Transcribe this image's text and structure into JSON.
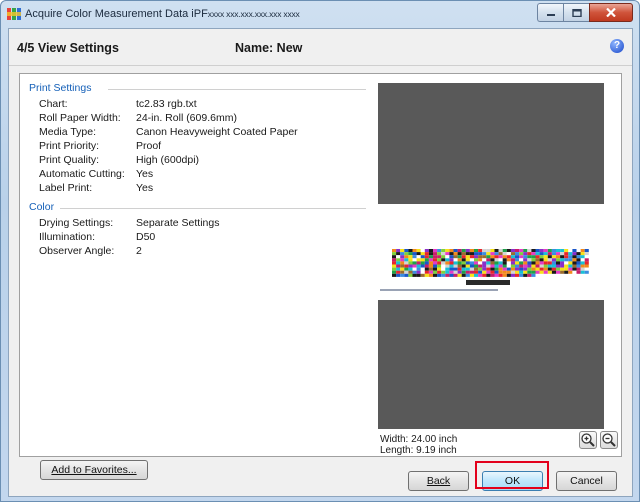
{
  "window": {
    "title": "Acquire Color Measurement Data iPF",
    "title_host": "xxxx xxx.xxx.xxx.xxx xxxx",
    "controls": [
      "minimize-icon",
      "maximize-icon",
      "close-icon"
    ]
  },
  "header": {
    "step": "4/5 View Settings",
    "name": "Name: New",
    "help": "?"
  },
  "print_settings": {
    "title": "Print Settings",
    "rows": [
      {
        "label": "Chart:",
        "value": "tc2.83 rgb.txt"
      },
      {
        "label": "Roll Paper Width:",
        "value": "24-in. Roll (609.6mm)"
      },
      {
        "label": "Media Type:",
        "value": "Canon Heavyweight Coated Paper"
      },
      {
        "label": "Print Priority:",
        "value": "Proof"
      },
      {
        "label": "Print Quality:",
        "value": "High (600dpi)"
      },
      {
        "label": "Automatic Cutting:",
        "value": "Yes"
      },
      {
        "label": "Label Print:",
        "value": "Yes"
      }
    ]
  },
  "color": {
    "title": "Color",
    "rows": [
      {
        "label": "Drying Settings:",
        "value": "Separate Settings"
      },
      {
        "label": "Illumination:",
        "value": "D50"
      },
      {
        "label": "Observer Angle:",
        "value": "2"
      }
    ]
  },
  "preview": {
    "width": "Width: 24.00 inch",
    "length": "Length: 9.19 inch",
    "zoom_in_icon": "zoom-in-icon",
    "zoom_out_icon": "zoom-out-icon",
    "background": "#595959"
  },
  "buttons": {
    "favorites": "Add to Favorites...",
    "back": "Back",
    "ok": "OK",
    "cancel": "Cancel"
  },
  "colors": {
    "accent": "#1560b8",
    "highlight": "#e3001b"
  }
}
